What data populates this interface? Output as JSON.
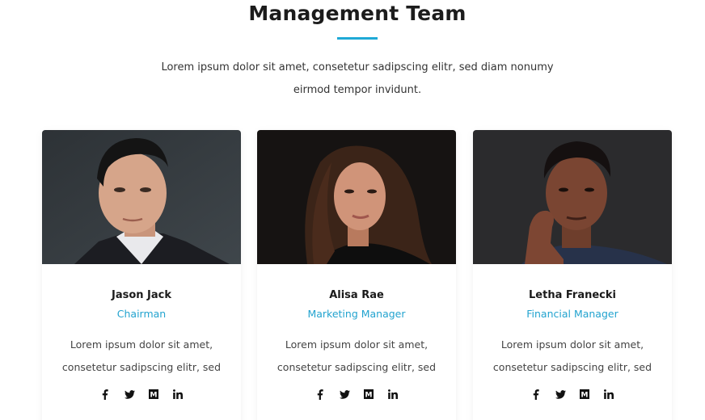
{
  "section": {
    "title": "Management Team",
    "intro": "Lorem ipsum dolor sit amet, consetetur sadipscing elitr, sed diam nonumy eirmod tempor invidunt."
  },
  "colors": {
    "accent": "#1fa9d6",
    "role_text": "#22a3cf"
  },
  "members": [
    {
      "name": "Jason Jack",
      "role": "Chairman",
      "bio": "Lorem ipsum dolor sit amet, consetetur sadipscing elitr, sed",
      "social": [
        "facebook-icon",
        "twitter-icon",
        "medium-icon",
        "linkedin-icon"
      ]
    },
    {
      "name": "Alisa Rae",
      "role": "Marketing Manager",
      "bio": "Lorem ipsum dolor sit amet, consetetur sadipscing elitr, sed",
      "social": [
        "facebook-icon",
        "twitter-icon",
        "medium-icon",
        "linkedin-icon"
      ]
    },
    {
      "name": "Letha Franecki",
      "role": "Financial Manager",
      "bio": "Lorem ipsum dolor sit amet, consetetur sadipscing elitr, sed",
      "social": [
        "facebook-icon",
        "twitter-icon",
        "medium-icon",
        "linkedin-icon"
      ]
    }
  ]
}
